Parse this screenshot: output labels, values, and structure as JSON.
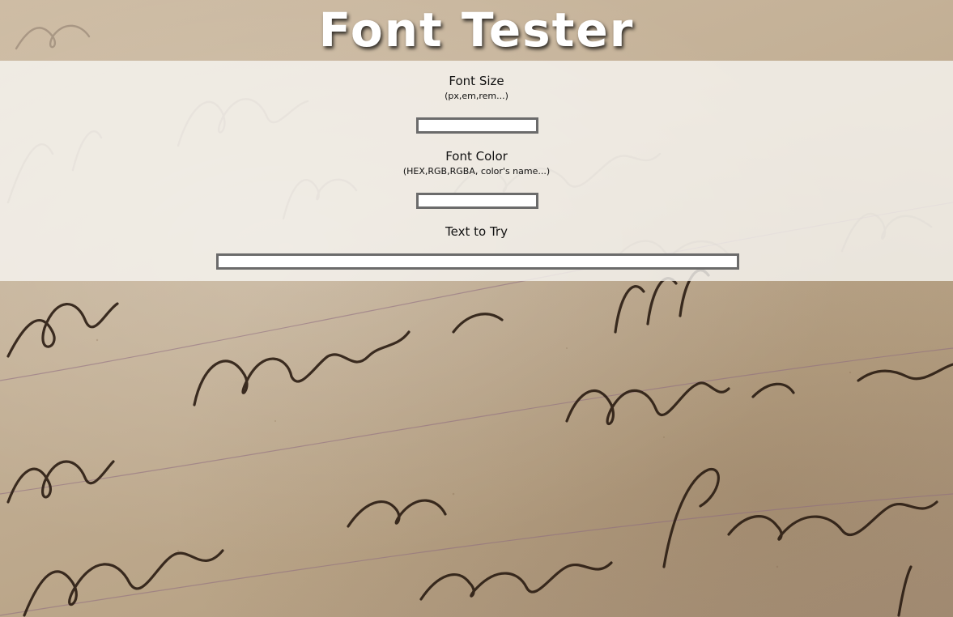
{
  "page": {
    "title": "Font Tester",
    "background_image": "handwritten-letter-paper"
  },
  "form": {
    "font_size": {
      "label": "Font Size",
      "hint": "(px,em,rem...)",
      "value": ""
    },
    "font_color": {
      "label": "Font Color",
      "hint": "(HEX,RGB,RGBA, color's name...)",
      "value": ""
    },
    "text_to_try": {
      "label": "Text to Try",
      "value": ""
    }
  },
  "colors": {
    "panel_background": "#f8f6f3",
    "input_border": "#6b6b6b",
    "title_text": "#ffffff",
    "ink": "#2a1c12",
    "paper": "#c4b197"
  }
}
